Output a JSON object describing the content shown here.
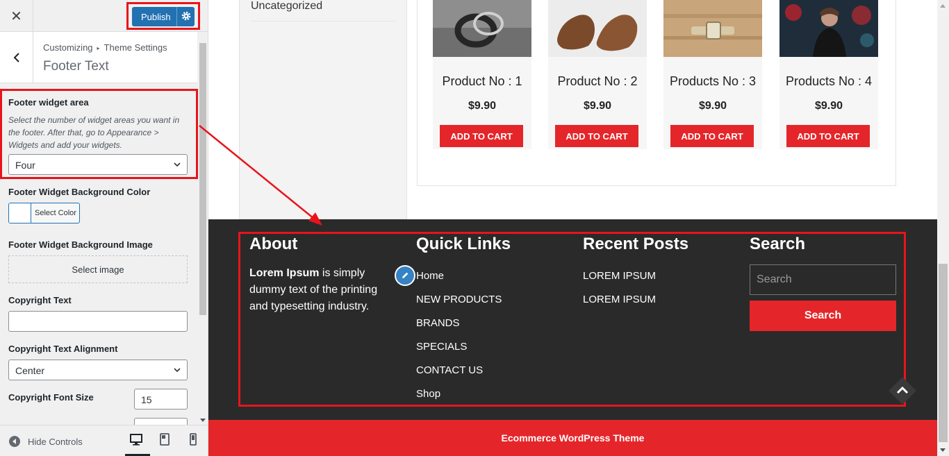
{
  "topbar": {
    "close_glyph": "✕",
    "publish_label": "Publish"
  },
  "section": {
    "breadcrumb_root": "Customizing",
    "breadcrumb_sep": "▸",
    "breadcrumb_parent": "Theme Settings",
    "title": "Footer Text"
  },
  "controls": {
    "footer_widget_area": {
      "label": "Footer widget area",
      "description": "Select the number of widget areas you want in the footer. After that, go to Appearance > Widgets and add your widgets.",
      "value": "Four"
    },
    "bg_color": {
      "label": "Footer Widget Background Color",
      "button": "Select Color"
    },
    "bg_image": {
      "label": "Footer Widget Background Image",
      "button": "Select image"
    },
    "copyright_text": {
      "label": "Copyright Text",
      "value": ""
    },
    "copyright_alignment": {
      "label": "Copyright Text Alignment",
      "value": "Center"
    },
    "copyright_font_size": {
      "label": "Copyright Font Size",
      "value": "15"
    }
  },
  "bottom_bar": {
    "hide_controls": "Hide Controls"
  },
  "preview": {
    "sidebar_category": "Uncategorized",
    "products": [
      {
        "name": "Product No : 1",
        "price": "$9.90",
        "button": "ADD TO CART"
      },
      {
        "name": "Product No : 2",
        "price": "$9.90",
        "button": "ADD TO CART"
      },
      {
        "name": "Products No : 3",
        "price": "$9.90",
        "button": "ADD TO CART"
      },
      {
        "name": "Products No : 4",
        "price": "$9.90",
        "button": "ADD TO CART"
      }
    ],
    "footer": {
      "about_title": "About",
      "about_bold": "Lorem Ipsum",
      "about_rest": " is simply dummy text of the printing and typesetting industry.",
      "quick_links_title": "Quick Links",
      "quick_links": [
        "Home",
        "NEW PRODUCTS",
        "BRANDS",
        "SPECIALS",
        "CONTACT US",
        "Shop"
      ],
      "recent_posts_title": "Recent Posts",
      "recent_posts": [
        "LOREM IPSUM",
        "LOREM IPSUM"
      ],
      "search_title": "Search",
      "search_placeholder": "Search",
      "search_button": "Search"
    },
    "copyright": "Ecommerce WordPress Theme"
  },
  "colors": {
    "wp_blue": "#2271b1",
    "theme_red": "#e4262a",
    "footer_bg": "#2a2a2a",
    "annotation_red": "#e8141b"
  }
}
